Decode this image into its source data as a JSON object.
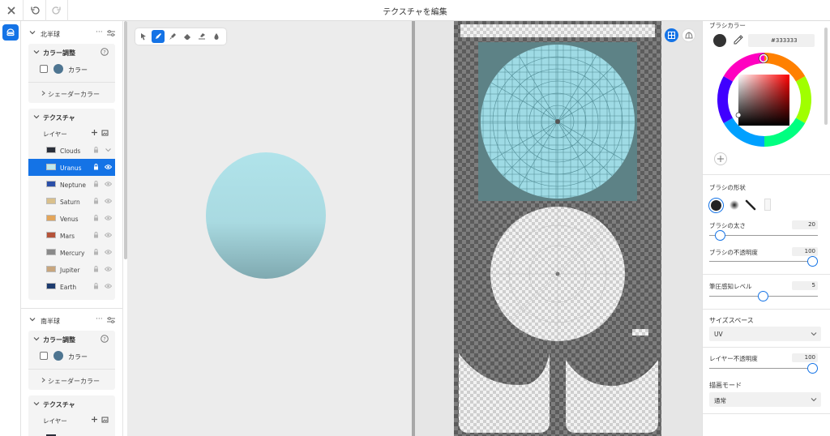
{
  "header": {
    "title": "テクスチャを編集"
  },
  "left_panel": {
    "north": {
      "title": "北半球",
      "color_adjust_title": "カラー調整",
      "color_label": "カラー",
      "shader_color_label": "シェーダーカラー",
      "texture_title": "テクスチャ",
      "layer_label": "レイヤー",
      "layers": [
        {
          "name": "Clouds",
          "selected": false
        },
        {
          "name": "Uranus",
          "selected": true
        },
        {
          "name": "Neptune",
          "selected": false
        },
        {
          "name": "Saturn",
          "selected": false
        },
        {
          "name": "Venus",
          "selected": false
        },
        {
          "name": "Mars",
          "selected": false
        },
        {
          "name": "Mercury",
          "selected": false
        },
        {
          "name": "Jupiter",
          "selected": false
        },
        {
          "name": "Earth",
          "selected": false
        }
      ]
    },
    "south": {
      "title": "南半球",
      "color_adjust_title": "カラー調整",
      "color_label": "カラー",
      "shader_color_label": "シェーダーカラー",
      "texture_title": "テクスチャ",
      "layer_label": "レイヤー"
    },
    "swatch_color": "#4e7591"
  },
  "right_panel": {
    "brush_color_title": "ブラシカラー",
    "hex_value": "#333333",
    "brush_shape_title": "ブラシの形状",
    "brush_size_label": "ブラシの太さ",
    "brush_size_value": "20",
    "brush_opacity_label": "ブラシの不透明度",
    "brush_opacity_value": "100",
    "pressure_label": "筆圧感知レベル",
    "pressure_value": "5",
    "size_space_title": "サイズスペース",
    "size_space_value": "UV",
    "layer_opacity_label": "レイヤー不透明度",
    "layer_opacity_value": "100",
    "draw_mode_title": "描画モード",
    "draw_mode_value": "通常"
  },
  "colors": {
    "accent": "#1473e6",
    "brush_color": "#333333",
    "planet_top": "#b0e3ea",
    "planet_bottom": "#7fa9b0",
    "uv_fill": "#9fdbe5"
  }
}
